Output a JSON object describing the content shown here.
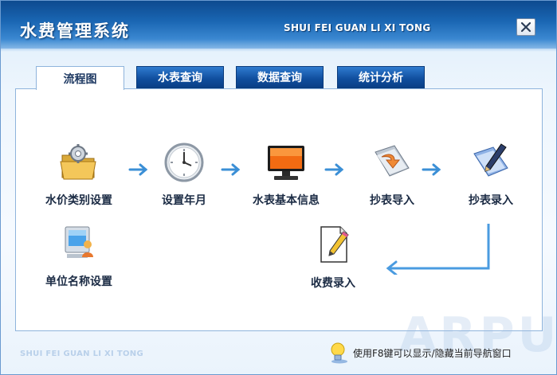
{
  "window": {
    "title": "水费管理系统",
    "title_en": "SHUI FEI GUAN LI XI TONG"
  },
  "tabs": [
    {
      "label": "流程图",
      "active": true
    },
    {
      "label": "水表查询",
      "active": false
    },
    {
      "label": "数据查询",
      "active": false
    },
    {
      "label": "统计分析",
      "active": false
    }
  ],
  "flow": {
    "nodes": [
      {
        "label": "水价类别设置",
        "icon": "folder-gear-icon"
      },
      {
        "label": "设置年月",
        "icon": "clock-icon"
      },
      {
        "label": "水表基本信息",
        "icon": "monitor-icon"
      },
      {
        "label": "抄表导入",
        "icon": "book-import-icon"
      },
      {
        "label": "抄表录入",
        "icon": "book-pen-icon"
      },
      {
        "label": "单位名称设置",
        "icon": "computer-user-icon"
      },
      {
        "label": "收费录入",
        "icon": "document-pen-icon"
      }
    ]
  },
  "footer": {
    "title_en": "SHUI FEI GUAN LI XI TONG",
    "hint": "使用F8键可以显示/隐藏当前导航窗口",
    "watermark": "ARPUN"
  },
  "colors": {
    "titlebar": "#1a66b3",
    "tab_inactive": "#0f4d9c",
    "arrow": "#3b8fd6"
  }
}
